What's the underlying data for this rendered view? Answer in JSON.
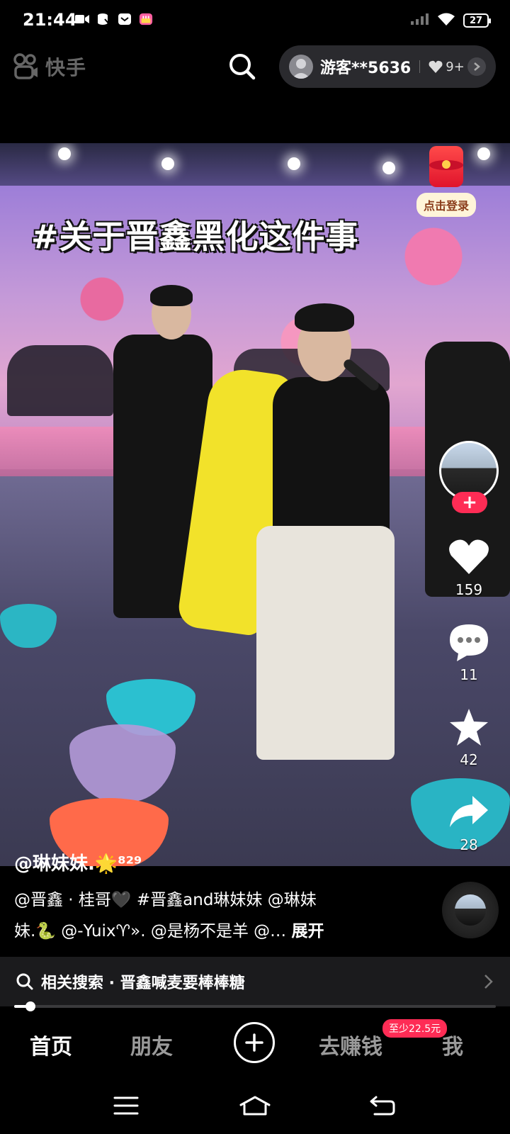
{
  "status_bar": {
    "time": "21:44",
    "battery": "27",
    "icons_left": [
      "video-camera-icon",
      "data-saver-icon",
      "mail-icon",
      "cake-app-icon"
    ],
    "icons_right": [
      "signal-icon",
      "wifi-icon",
      "battery-icon"
    ]
  },
  "app_bar": {
    "logo_text": "快手",
    "search_icon": "search-icon",
    "user": {
      "name": "游客**5636",
      "likes": "9+",
      "arrow_icon": "chevron-right-icon"
    }
  },
  "video": {
    "hashtag_title": "#关于晋鑫黑化这件事"
  },
  "right_rail": {
    "login_label": "点击登录",
    "follow_label": "+",
    "like_count": "159",
    "comment_count": "11",
    "favorite_count": "42",
    "share_count": "28"
  },
  "caption": {
    "author": "@琳妹妹.🌟⁸²⁹",
    "line1": "@晋鑫 · 桂哥🖤 #晋鑫and琳妹妹 @琳妹",
    "line2": "妹.🐍 @-Yuix♈︎». @是杨不是羊 @… ",
    "expand": "展开"
  },
  "related_search": {
    "text": "相关搜索 · 晋鑫喊麦要棒棒糖"
  },
  "playback": {
    "progress": 0.03
  },
  "bottom_nav": {
    "home": "首页",
    "friends": "朋友",
    "earn": "去赚钱",
    "earn_badge": "至少22.5元",
    "me": "我"
  },
  "colors": {
    "accent": "#fe2c55",
    "background": "#000000",
    "pill": "#2a2a2e"
  }
}
